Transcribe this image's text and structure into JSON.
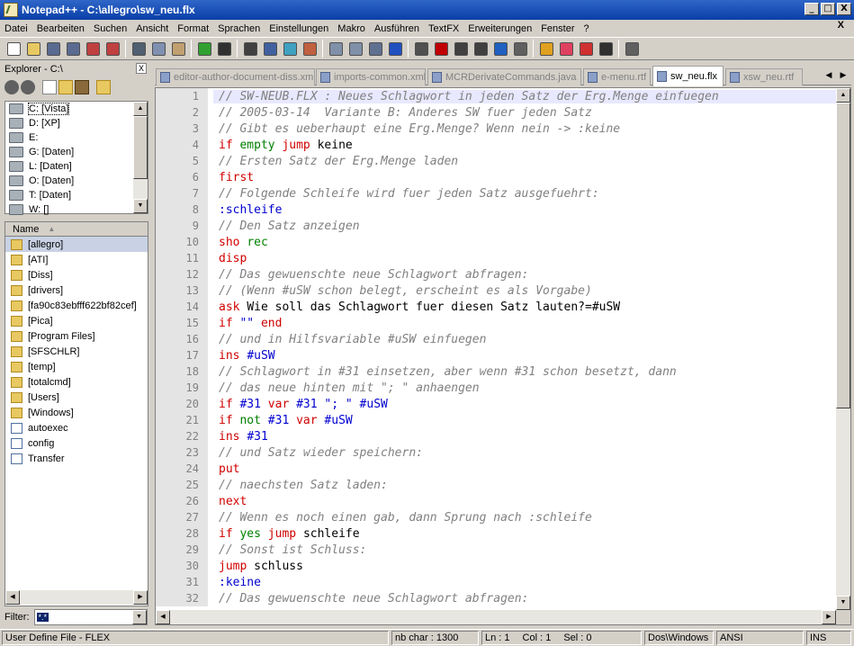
{
  "window": {
    "title": "Notepad++ - C:\\allegro\\sw_neu.flx",
    "minimize_label": "_",
    "maximize_label": "□",
    "close_label": "X"
  },
  "menu": {
    "items": [
      "Datei",
      "Bearbeiten",
      "Suchen",
      "Ansicht",
      "Format",
      "Sprachen",
      "Einstellungen",
      "Makro",
      "Ausführen",
      "TextFX",
      "Erweiterungen",
      "Fenster",
      "?"
    ],
    "close_label": "X"
  },
  "toolbar": {
    "buttons": [
      "new",
      "open",
      "save",
      "save-all",
      "close",
      "close-all",
      "cut",
      "copy",
      "paste",
      "undo",
      "redo",
      "find",
      "replace",
      "zoom-in",
      "zoom-out",
      "sync-v",
      "sync-h",
      "wrap",
      "show-all",
      "indent-guide",
      "record",
      "stop",
      "play",
      "play-multiple",
      "save-macro",
      "monitor",
      "favorite",
      "spell",
      "html",
      "print"
    ]
  },
  "explorer": {
    "title": "Explorer - C:\\",
    "close_label": "X",
    "drives": [
      "C: [Vista]",
      "D: [XP]",
      "E:",
      "G: [Daten]",
      "L: [Daten]",
      "O: [Daten]",
      "T: [Daten]",
      "W: []"
    ],
    "selected_drive": 0,
    "column_header": "Name",
    "files": [
      {
        "name": "[allegro]",
        "type": "folder"
      },
      {
        "name": "[ATI]",
        "type": "folder"
      },
      {
        "name": "[Diss]",
        "type": "folder"
      },
      {
        "name": "[drivers]",
        "type": "folder"
      },
      {
        "name": "[fa90c83ebfff622bf82cef]",
        "type": "folder"
      },
      {
        "name": "[Pica]",
        "type": "folder"
      },
      {
        "name": "[Program Files]",
        "type": "folder"
      },
      {
        "name": "[SFSCHLR]",
        "type": "folder"
      },
      {
        "name": "[temp]",
        "type": "folder"
      },
      {
        "name": "[totalcmd]",
        "type": "folder"
      },
      {
        "name": "[Users]",
        "type": "folder"
      },
      {
        "name": "[Windows]",
        "type": "folder"
      },
      {
        "name": "autoexec",
        "type": "file"
      },
      {
        "name": "config",
        "type": "file"
      },
      {
        "name": "Transfer",
        "type": "file"
      }
    ],
    "selected_file": 0,
    "filter_label": "Filter:",
    "filter_value": "*.*"
  },
  "tabs": [
    {
      "label": "editor-author-document-diss.xml",
      "active": false
    },
    {
      "label": "imports-common.xml",
      "active": false
    },
    {
      "label": "MCRDerivateCommands.java",
      "active": false
    },
    {
      "label": "e-menu.rtf",
      "active": false
    },
    {
      "label": "sw_neu.flx",
      "active": true
    },
    {
      "label": "xsw_neu.rtf",
      "active": false
    }
  ],
  "code": [
    {
      "n": "1",
      "parts": [
        [
          "c",
          "// SW-NEUB.FLX : Neues Schlagwort in jeden Satz der Erg.Menge einfuegen"
        ]
      ]
    },
    {
      "n": "2",
      "parts": [
        [
          "c",
          "// 2005-03-14  Variante B: Anderes SW fuer jeden Satz"
        ]
      ]
    },
    {
      "n": "3",
      "parts": [
        [
          "c",
          "// Gibt es ueberhaupt eine Erg.Menge? Wenn nein -> :keine"
        ]
      ]
    },
    {
      "n": "4",
      "parts": [
        [
          "k",
          "if "
        ],
        [
          "g",
          "empty "
        ],
        [
          "k",
          "jump "
        ],
        [
          "n",
          "keine"
        ]
      ]
    },
    {
      "n": "5",
      "parts": [
        [
          "c",
          "// Ersten Satz der Erg.Menge laden"
        ]
      ]
    },
    {
      "n": "6",
      "parts": [
        [
          "k",
          "first"
        ]
      ]
    },
    {
      "n": "7",
      "parts": [
        [
          "c",
          "// Folgende Schleife wird fuer jeden Satz ausgefuehrt:"
        ]
      ]
    },
    {
      "n": "8",
      "parts": [
        [
          "b",
          ":schleife"
        ]
      ]
    },
    {
      "n": "9",
      "parts": [
        [
          "c",
          "// Den Satz anzeigen"
        ]
      ]
    },
    {
      "n": "10",
      "parts": [
        [
          "k",
          "sho "
        ],
        [
          "g",
          "rec"
        ]
      ]
    },
    {
      "n": "11",
      "parts": [
        [
          "k",
          "disp"
        ]
      ]
    },
    {
      "n": "12",
      "parts": [
        [
          "c",
          "// Das gewuenschte neue Schlagwort abfragen:"
        ]
      ]
    },
    {
      "n": "13",
      "parts": [
        [
          "c",
          "// (Wenn #uSW schon belegt, erscheint es als Vorgabe)"
        ]
      ]
    },
    {
      "n": "14",
      "parts": [
        [
          "k",
          "ask "
        ],
        [
          "n",
          "Wie soll das Schlagwort fuer diesen Satz lauten?=#uSW"
        ]
      ]
    },
    {
      "n": "15",
      "parts": [
        [
          "k",
          "if "
        ],
        [
          "b",
          "\"\" "
        ],
        [
          "k",
          "end"
        ]
      ]
    },
    {
      "n": "16",
      "parts": [
        [
          "c",
          "// und in Hilfsvariable #uSW einfuegen"
        ]
      ]
    },
    {
      "n": "17",
      "parts": [
        [
          "k",
          "ins "
        ],
        [
          "b",
          "#uSW"
        ]
      ]
    },
    {
      "n": "18",
      "parts": [
        [
          "c",
          "// Schlagwort in #31 einsetzen, aber wenn #31 schon besetzt, dann"
        ]
      ]
    },
    {
      "n": "19",
      "parts": [
        [
          "c",
          "// das neue hinten mit \"; \" anhaengen"
        ]
      ]
    },
    {
      "n": "20",
      "parts": [
        [
          "k",
          "if "
        ],
        [
          "b",
          "#31 "
        ],
        [
          "k",
          "var "
        ],
        [
          "b",
          "#31 \"; \" #uSW"
        ]
      ]
    },
    {
      "n": "21",
      "parts": [
        [
          "k",
          "if "
        ],
        [
          "g",
          "not "
        ],
        [
          "b",
          "#31 "
        ],
        [
          "k",
          "var "
        ],
        [
          "b",
          "#uSW"
        ]
      ]
    },
    {
      "n": "22",
      "parts": [
        [
          "k",
          "ins "
        ],
        [
          "b",
          "#31"
        ]
      ]
    },
    {
      "n": "23",
      "parts": [
        [
          "c",
          "// und Satz wieder speichern:"
        ]
      ]
    },
    {
      "n": "24",
      "parts": [
        [
          "k",
          "put"
        ]
      ]
    },
    {
      "n": "25",
      "parts": [
        [
          "c",
          "// naechsten Satz laden:"
        ]
      ]
    },
    {
      "n": "26",
      "parts": [
        [
          "k",
          "next"
        ]
      ]
    },
    {
      "n": "27",
      "parts": [
        [
          "c",
          "// Wenn es noch einen gab, dann Sprung nach :schleife"
        ]
      ]
    },
    {
      "n": "28",
      "parts": [
        [
          "k",
          "if "
        ],
        [
          "g",
          "yes "
        ],
        [
          "k",
          "jump "
        ],
        [
          "n",
          "schleife"
        ]
      ]
    },
    {
      "n": "29",
      "parts": [
        [
          "c",
          "// Sonst ist Schluss:"
        ]
      ]
    },
    {
      "n": "30",
      "parts": [
        [
          "k",
          "jump "
        ],
        [
          "n",
          "schluss"
        ]
      ]
    },
    {
      "n": "31",
      "parts": [
        [
          "b",
          ":keine"
        ]
      ]
    },
    {
      "n": "32",
      "parts": [
        [
          "c",
          "// Das gewuenschte neue Schlagwort abfragen:"
        ]
      ]
    }
  ],
  "status": {
    "language": "User Define File - FLEX",
    "chars": "nb char : 1300",
    "ln": "Ln : 1",
    "col": "Col : 1",
    "sel": "Sel : 0",
    "eol": "Dos\\Windows",
    "encoding": "ANSI",
    "mode": "INS"
  },
  "colors": {
    "comment": "#808080",
    "keyword": "#d00000",
    "operator": "#0000d0",
    "condition": "#008000",
    "title_bar": "#0a3fa8"
  }
}
